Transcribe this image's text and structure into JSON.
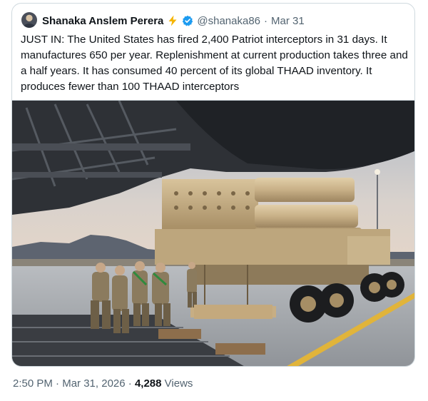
{
  "tweet": {
    "display_name": "Shanaka Anslem Perera",
    "handle": "@shanaka86",
    "separator": "·",
    "date": "Mar 31",
    "text": "JUST IN: The United States has fired 2,400 Patriot interceptors in 31 days. It manufactures 650 per year. Replenishment at current production takes three and a half years. It has consumed 40 percent of its global THAAD inventory. It produces fewer than 100 THAAD interceptors",
    "icons": {
      "avatar": "profile-photo",
      "badge_emoji": "lightning-bolt-icon",
      "verified": "verified-badge-icon"
    },
    "colors": {
      "verified_blue": "#1d9bf0",
      "bolt_yellow": "#f5b400",
      "text": "#0f1419",
      "secondary_text": "#536471",
      "border": "#cfd9de"
    }
  },
  "footer": {
    "time": "2:50 PM",
    "date": "Mar 31, 2026",
    "views_count": "4,288",
    "views_label": "Views",
    "separator": "·"
  }
}
